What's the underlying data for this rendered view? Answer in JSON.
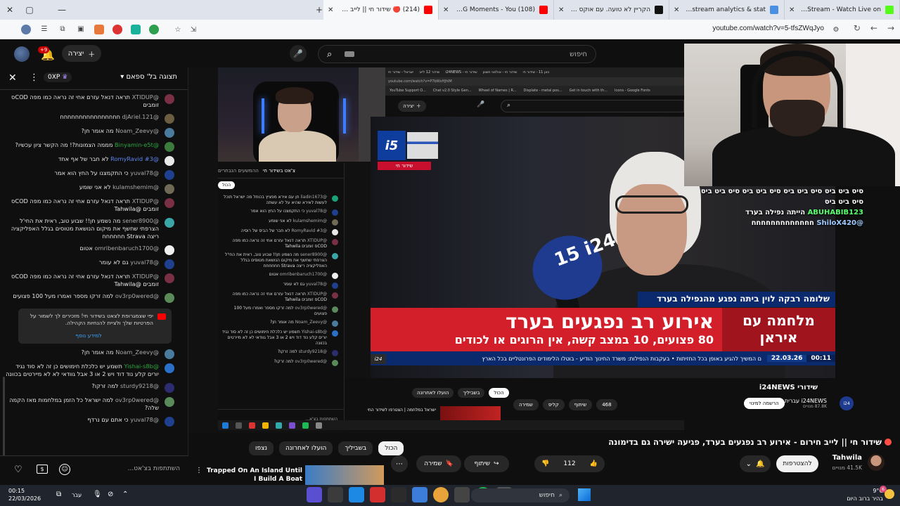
{
  "browser": {
    "tabs": [
      {
        "label": "LiorsLife Stream - Watch Live on",
        "favicon_color": "#53fc18",
        "active": false
      },
      {
        "label": "odedsvr stream analytics & stat",
        "favicon_color": "#4a90e2",
        "active": false
      },
      {
        "label": "הקריין לא טועה. עם אוקס יש רוב",
        "favicon_color": "#111111",
        "active": false
      },
      {
        "label": "(108) RonenGG Moments - You",
        "favicon_color": "#ff0000",
        "active": false
      },
      {
        "label": "(214) 🔴 שידור חי || לייב חירום",
        "favicon_color": "#ff0000",
        "active": true
      }
    ],
    "url": "youtube.com/watch?v=5-tfsZWqJyo",
    "new_tab_symbol": "+"
  },
  "yt_header": {
    "create_label": "יצירה",
    "notifications_count": "+9",
    "search_placeholder": "חיפוש"
  },
  "chat": {
    "mode_label": "תצוגה בל' ספאם",
    "xp_label": "0XP",
    "messages": [
      {
        "user": "@XTIDUP",
        "text": "תראה דנאל עזרם אחי זה נראה כמו מפה CODס זומבים",
        "avatar": "#7a3044",
        "user_class": ""
      },
      {
        "user": "@djAriel.121",
        "text": "חחחחחחחחחחחחחחחח",
        "avatar": "#6a5d40",
        "user_class": ""
      },
      {
        "user": "@Noam_Zeevy",
        "text": "מה אומר חן?",
        "avatar": "#4a7a9c",
        "user_class": ""
      },
      {
        "user": "@Binyamin-e5t",
        "text": "מממה הצמונות?! מה הקשר ציון עכשיו?",
        "avatar": "#3d7a3d",
        "user_class": "green"
      },
      {
        "user": "@RomyRavid #3",
        "text": "לא חבר של אף אחד",
        "avatar": "#e8e8e8",
        "user_class": "mod"
      },
      {
        "user": "@yuval78",
        "text": "כי התקמצנו על החץ הוא אמר",
        "avatar": "#1f3f8f",
        "user_class": ""
      },
      {
        "user": "@kulamshemim",
        "text": "לא אני שומע",
        "avatar": "#6f6a55",
        "user_class": ""
      },
      {
        "user": "@XTIDUP",
        "text": "תראה דנאל עזרם אחי זה נראה כמו מפה CODס זומבים @Tahwila",
        "avatar": "#7a3044",
        "user_class": ""
      },
      {
        "user": "@sener8900",
        "text": "מה נשמע חן!! שבוע טוב, ראית את החי'ל הצרפתי שחשף את מיקום הנושאת מטוסים בגלל האפליקציה ריצה Strava חחחחחח",
        "avatar": "#3aa6a6",
        "user_class": ""
      },
      {
        "user": "@omribenbaruch1700",
        "text": "אטום",
        "avatar": "#f0f0f0",
        "user_class": ""
      },
      {
        "user": "@yuval78",
        "text": "גם לא עומר",
        "avatar": "#1f3f8f",
        "user_class": ""
      },
      {
        "user": "@XTIDUP",
        "text": "תראה דנאל עזרם אחי זה נראה כמו מפה CODס זומבים @Tahwila",
        "avatar": "#7a3044",
        "user_class": ""
      },
      {
        "user": "@ov3rp0wered",
        "text": "למה זרקו מספר ואמרו מעל 100 פצועים",
        "avatar": "#5a8a5a",
        "user_class": ""
      }
    ],
    "pinned": {
      "text": "יפי שצמגרופת לצאט בשידור חי! מזכירים לך לשמור על הפרטיות שלך ולציית להנחיות הקהילה.",
      "more_label": "למידע נוסף"
    },
    "messages_after": [
      {
        "user": "@Noam_Zeevy",
        "text": "מה אומר חן?",
        "avatar": "#4a7a9c",
        "user_class": ""
      },
      {
        "user": "@Yishai-s8b",
        "text": "תשמע יש כלכלת חימושים כן זה לא סוד נגיד יורים קלע נוד דוד ויש 2 או 3 אבל גוודאי לא לא מיירטים בכוונה",
        "avatar": "#2a6fc8",
        "user_class": "green"
      },
      {
        "user": "@sturdy9218",
        "text": "למה זרקו?",
        "avatar": "#2c2c6e",
        "user_class": ""
      },
      {
        "user": "@ov3rp0wered",
        "text": "למה ישראל כל הזמן במלחמות מאז הקמה שלה?",
        "avatar": "#5a8a5a",
        "user_class": ""
      },
      {
        "user": "@yuval78",
        "text": "כי אתם עם נרדף",
        "avatar": "#1f3f8f",
        "user_class": ""
      }
    ],
    "input_placeholder": "השתתפות בצ'אט..."
  },
  "inner_chat": {
    "header": "צ'אט בשידור חי",
    "header_sub": "ההמשעים הנבחרים",
    "chip": "הכול",
    "messages": [
      {
        "user": "@liadin1673",
        "text": "חן עם אירא מפציץ בכוחל מה ישראל תוכל לעשות לאירא שהיא על לא עשתה",
        "avatar": "#1aa37a"
      },
      {
        "user": "@yuval78",
        "text": "כי התקמצנו על החץ הוא אמר",
        "avatar": "#1f3f8f"
      },
      {
        "user": "@kulamshemim",
        "text": "לא אני שומע",
        "avatar": "#6f6a55"
      },
      {
        "user": "@RomyRavid #3",
        "text": "לא חבר של הביס של רוסיה",
        "avatar": "#e8e8e8"
      },
      {
        "user": "@XTIDUP",
        "text": "תראה דנאל עזרם אחי זה נראה כמו מפה CODס זומבים Tahwila",
        "avatar": "#7a3044"
      },
      {
        "user": "@sener8900",
        "text": "מה נשמע חן!! שבוע טוב, ראית את החי'ל הצרפתי שחשף את מיקום הנושאת מטוסים בגלל האפליקציה ריצה Strava חחחחחח",
        "avatar": "#3aa6a6"
      },
      {
        "user": "@omribenbaruch1700",
        "text": "אטום",
        "avatar": "#f0f0f0"
      },
      {
        "user": "@yuval78",
        "text": "גם לא עומר",
        "avatar": "#1f3f8f"
      },
      {
        "user": "@XTIDUP",
        "text": "תראה דנאל עזרם אחי זה נראה כמו מפה CODס זומבים Tahwila",
        "avatar": "#7a3044"
      },
      {
        "user": "@ov3rp0wered",
        "text": "למה זרקו מספר ואמרו מעל 100 פצועים",
        "avatar": "#5a8a5a"
      },
      {
        "user": "@Noam_Zeevy",
        "text": "מה אומר חן?",
        "avatar": "#4a7a9c"
      },
      {
        "user": "@Yishai-s8b",
        "text": "תשמע יש כלכלת חימושים כן זה לא סוד נגיד יורים קלע נוד דוד ויש 2 או 3 אבל גוודאי לא לא מיירטים בכוונה",
        "avatar": "#2a6fc8"
      },
      {
        "user": "@sturdy9218",
        "text": "למה זרקו?",
        "avatar": "#2c2c6e"
      },
      {
        "user": "@ov3rp0wered",
        "text": "למה זרקו?",
        "avatar": "#5a8a5a"
      }
    ],
    "input_placeholder": "השתתפות בצ'א..."
  },
  "inner_browser": {
    "tabs": [
      "ישראל - שידור חי",
      "שידור 12 לייב",
      "i24NEWS - שידור חי",
      "שידור חי - אולפני חשוון",
      "כאן 11 - שידור חי"
    ],
    "url": "youtube.com/watch?v=P7bWxHJhlM",
    "bookmarks": [
      "YouTube Support O...",
      "Chat v2.0 Style Gen...",
      "Wheel of Names | R...",
      "Displate - metal pos...",
      "Get in touch with th...",
      "Icons - Google Fonts"
    ],
    "create_label": "יצירה"
  },
  "news": {
    "logo": "i5",
    "live_label": "שידור חי",
    "mic_text": "15 i24",
    "nameplate": "שלומה רבקה לוין  ביתה נפגע מהנפילה בערד",
    "headline": "אירוע רב נפגעים בערד",
    "subline": "80 פצועים, 10 במצב קשה, אין הרוגים או לכודים",
    "war_label": "מלחמה עם איראן",
    "time": "00:11",
    "date": "22.03.26",
    "ticker": "ם המשיך להגיע באופן בכל החזיתות   •   בעקבות הנפילות: משרד החינוך הודיע - בוטלו הלימודים הפרונטליים בכל הארץ",
    "ticker_logo": "i24"
  },
  "overlay_chat": {
    "lines": [
      {
        "user": "",
        "text": "סיס ביט ביס סיס ביט ביס סיס ביט ביס סיס ביט ביס"
      },
      {
        "user": "",
        "text": "סיס ביט ביס"
      },
      {
        "user": "ABUHABIB123",
        "text": "הייתה נפילה בערד"
      },
      {
        "user": "@ShiloX420",
        "text": "חחחחחחחחחחחחח"
      }
    ]
  },
  "inner_info": {
    "channel_title": "שידורי i24NEWS",
    "chips": [
      "הכול",
      "בשביליך",
      "הועלו לאחרונה"
    ],
    "actions": [
      "שמירה",
      "קליפ",
      "שיתוף",
      "468"
    ],
    "subscribe": "הרשמה למינוי",
    "channel_name": "i24NEWS עברית",
    "subs": "87.8K מנויים",
    "rec_title": "ישראל במלחמה | הצטרפו לשידור החי"
  },
  "video": {
    "title": "שידור חי || לייב חירום - אירוע רב נפגעים בערד, פגיעה ישירה גם בדימונה",
    "channel": "Tahwila",
    "subscribers": "41.5K מנויים",
    "subscribe_label": "להצטרפות",
    "likes": "112",
    "share_label": "שיתוף",
    "save_label": "שמירה",
    "more_symbol": "⋯",
    "chips": [
      "הכול",
      "בשביליך",
      "הועלו לאחרונה",
      "נצפו"
    ],
    "recommended_title": "Trapped On An Island Until I Build A Boat"
  },
  "taskbar": {
    "time": "00:15",
    "date": "22/03/2026",
    "lang": "עבר",
    "search_label": "חיפוש",
    "weather_temp": "9°C",
    "weather_desc": "בהיר ברוב היום",
    "weather_badge": "6"
  }
}
